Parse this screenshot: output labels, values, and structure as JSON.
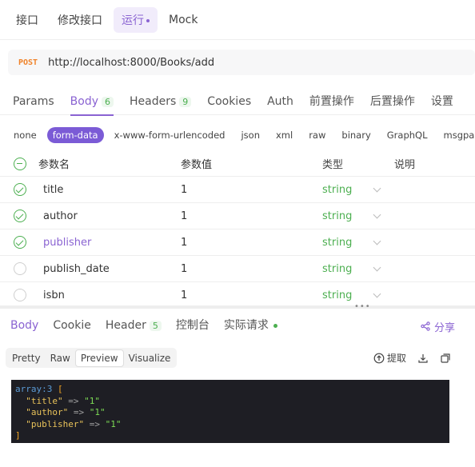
{
  "top_tabs": [
    {
      "label": "接口",
      "active": false
    },
    {
      "label": "修改接口",
      "active": false
    },
    {
      "label": "运行",
      "active": true
    },
    {
      "label": "Mock",
      "active": false
    }
  ],
  "request": {
    "method": "POST",
    "url": "http://localhost:8000/Books/add"
  },
  "request_tabs": {
    "params": "Params",
    "body": "Body",
    "body_count": "6",
    "headers": "Headers",
    "headers_count": "9",
    "cookies": "Cookies",
    "auth": "Auth",
    "pre_ops": "前置操作",
    "post_ops": "后置操作",
    "settings": "设置"
  },
  "body_types": [
    "none",
    "form-data",
    "x-www-form-urlencoded",
    "json",
    "xml",
    "raw",
    "binary",
    "GraphQL",
    "msgpack"
  ],
  "body_type_active": "form-data",
  "params_table": {
    "headers": {
      "name": "参数名",
      "value": "参数值",
      "type": "类型",
      "desc": "说明"
    },
    "rows": [
      {
        "name": "title",
        "value": "1",
        "type": "string",
        "checked": true
      },
      {
        "name": "author",
        "value": "1",
        "type": "string",
        "checked": true
      },
      {
        "name": "publisher",
        "value": "1",
        "type": "string",
        "checked": true
      },
      {
        "name": "publish_date",
        "value": "1",
        "type": "string",
        "checked": false
      },
      {
        "name": "isbn",
        "value": "1",
        "type": "string",
        "checked": false
      }
    ]
  },
  "response_tabs": {
    "body": "Body",
    "cookie": "Cookie",
    "header": "Header",
    "header_count": "5",
    "console": "控制台",
    "actual_request": "实际请求",
    "share": "分享"
  },
  "view_modes": [
    "Pretty",
    "Raw",
    "Preview",
    "Visualize"
  ],
  "view_mode_active": "Preview",
  "tools": {
    "extract": "提取"
  },
  "response_code": {
    "line1_type": "array:3",
    "open": "[",
    "entries": [
      {
        "key": "\"title\"",
        "arrow": "=>",
        "value": "\"1\""
      },
      {
        "key": "\"author\"",
        "arrow": "=>",
        "value": "\"1\""
      },
      {
        "key": "\"publisher\"",
        "arrow": "=>",
        "value": "\"1\""
      }
    ],
    "close": "]"
  },
  "colors": {
    "accent": "#8a63d2",
    "success": "#4caf50",
    "method_post": "#f0832a",
    "code_bg": "#1e1e24"
  }
}
